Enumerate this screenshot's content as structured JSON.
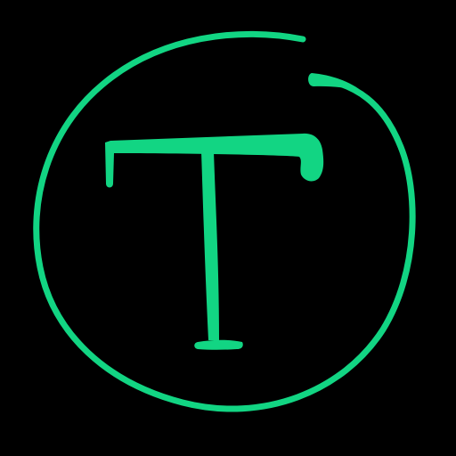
{
  "logo": {
    "letter": "T",
    "accent_color": "#12D583",
    "background_color": "#000000",
    "icon": "hand-drawn-circled-letter-icon"
  }
}
